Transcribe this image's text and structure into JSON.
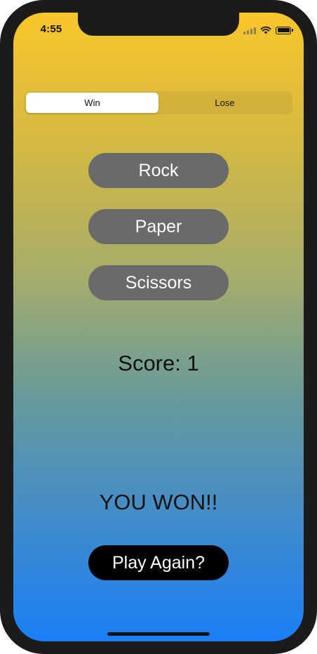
{
  "status_bar": {
    "time": "4:55"
  },
  "mode_selector": {
    "segments": [
      {
        "label": "Win",
        "selected": true
      },
      {
        "label": "Lose",
        "selected": false
      }
    ]
  },
  "choices": {
    "rock": "Rock",
    "paper": "Paper",
    "scissors": "Scissors"
  },
  "score_text": "Score: 1",
  "result_text": "YOU WON!!",
  "play_again_label": "Play Again?",
  "colors": {
    "gradient_top": "#f9c62a",
    "gradient_bottom": "#1a7ff6",
    "choice_button": "#6a6a6a",
    "play_again_button": "#000000"
  },
  "icons": [
    "signal-icon",
    "wifi-icon",
    "battery-icon"
  ]
}
